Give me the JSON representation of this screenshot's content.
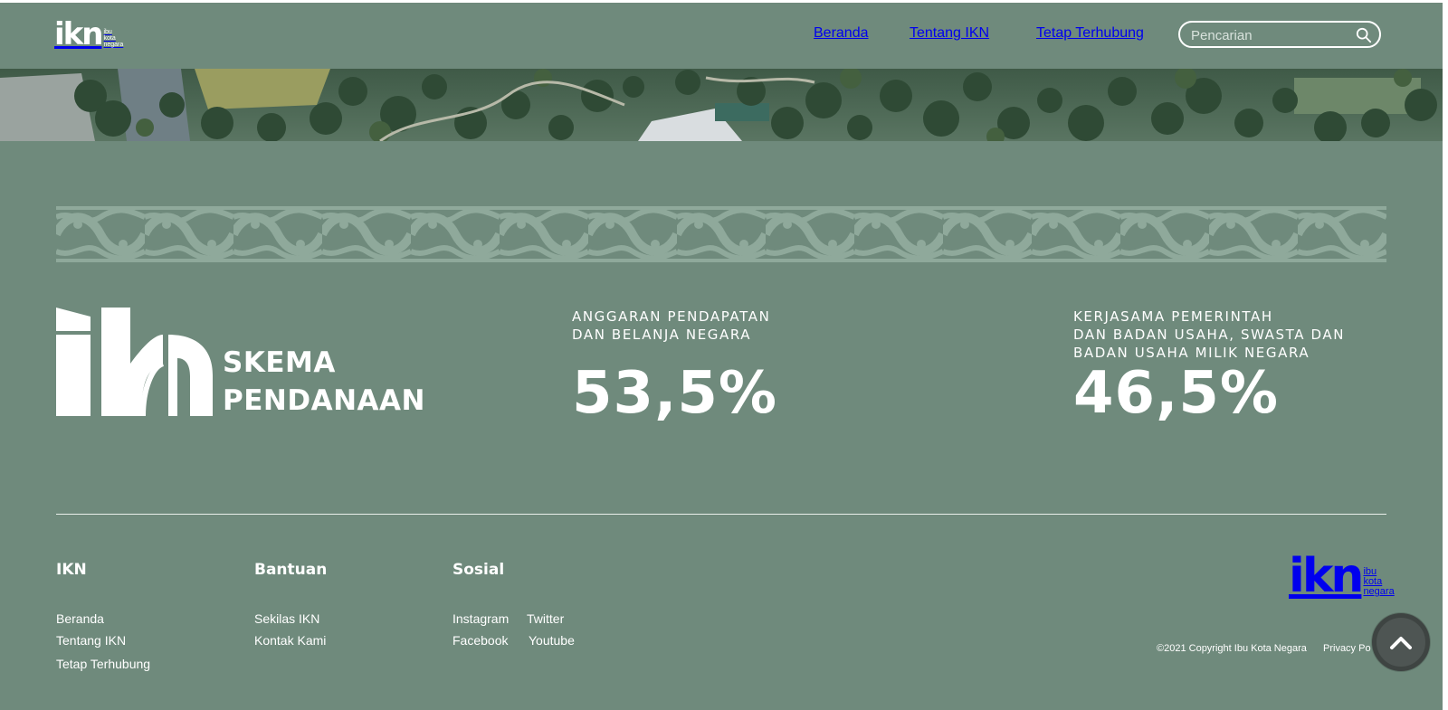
{
  "header": {
    "logo_mark": "ikn",
    "logo_sub": [
      "ibu",
      "kota",
      "negara"
    ],
    "nav": [
      {
        "label": "Beranda"
      },
      {
        "label": "Tentang IKN"
      },
      {
        "label": "Tetap Terhubung"
      }
    ],
    "search": {
      "placeholder": "Pencarian",
      "value": "",
      "icon": "search-icon"
    }
  },
  "funding": {
    "logo_mark": "ikn",
    "title_line1": "SKEMA",
    "title_line2": "PENDANAAN",
    "stats": [
      {
        "label_lines": [
          "ANGGARAN PENDAPATAN",
          "DAN BELANJA NEGARA"
        ],
        "value": "53,5%"
      },
      {
        "label_lines": [
          "KERJASAMA PEMERINTAH",
          "DAN BADAN USAHA, SWASTA DAN",
          "BADAN USAHA MILIK NEGARA"
        ],
        "value": "46,5%"
      }
    ]
  },
  "footer": {
    "columns": [
      {
        "title": "IKN",
        "links": [
          "Beranda",
          "Tentang IKN",
          "Tetap Terhubung"
        ]
      },
      {
        "title": "Bantuan",
        "links": [
          "Sekilas IKN",
          "Kontak Kami"
        ]
      },
      {
        "title": "Sosial",
        "links": [
          "Instagram",
          "Twitter",
          "Facebook",
          "Youtube"
        ]
      }
    ],
    "logo_mark": "ikn",
    "logo_sub": [
      "ibu",
      "kota",
      "negara"
    ],
    "copyright": "©2021 Copyright Ibu Kota Negara",
    "privacy": "Privacy Po",
    "scroll_top_icon": "chevron-up-icon"
  },
  "colors": {
    "background": "#6f8a7c",
    "ornament": "#8fa99b",
    "text": "#ffffff",
    "scroll_button": "#4e5553"
  }
}
